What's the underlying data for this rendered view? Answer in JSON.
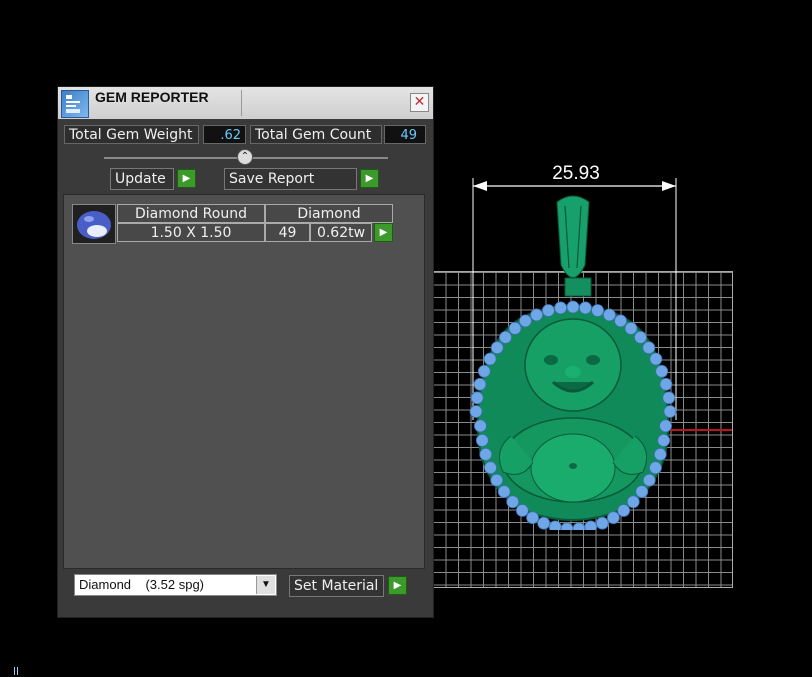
{
  "window": {
    "title": "GEM REPORTER",
    "close_symbol": "✕"
  },
  "summary": {
    "total_weight_label": "Total Gem Weight",
    "total_weight_value": ".62",
    "total_count_label": "Total Gem Count",
    "total_count_value": "49"
  },
  "toolbar": {
    "update_label": "Update",
    "save_report_label": "Save Report"
  },
  "gem_table": {
    "header": [
      "Diamond Round",
      "Diamond"
    ],
    "rows": [
      {
        "size": "1.50 X 1.50",
        "count": "49",
        "weight": "0.62tw"
      }
    ]
  },
  "material": {
    "selected": "Diamond    (3.52 spg)",
    "set_label": "Set Material"
  },
  "viewport": {
    "dimension": "25.93"
  },
  "colors": {
    "accent_green": "#3c9a2a",
    "value_cyan": "#66ccff",
    "model_green": "#0f8a58",
    "gem_blue": "#6fa7e6",
    "axis_red": "#c0141b"
  },
  "icons": [
    "gem-reporter-app-icon",
    "close-icon",
    "play-arrow-icon",
    "dropdown-arrow-icon",
    "gem-thumbnail"
  ]
}
